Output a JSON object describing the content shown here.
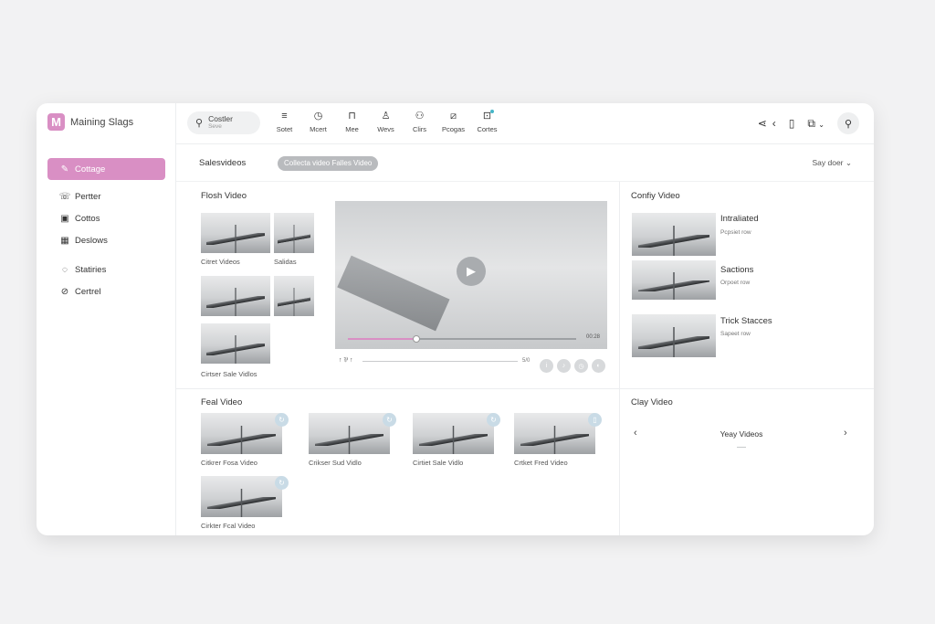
{
  "brand": {
    "logo": "M",
    "name": "Maining Slags"
  },
  "sidebar": {
    "items": [
      {
        "label": "Cottage",
        "icon": "pen-icon",
        "glyph": "✎",
        "active": true
      },
      {
        "label": "Pertter",
        "icon": "phone-icon",
        "glyph": "☏",
        "active": false
      },
      {
        "label": "Cottos",
        "icon": "camera-icon",
        "glyph": "▣",
        "active": false
      },
      {
        "label": "Deslows",
        "icon": "grid-icon",
        "glyph": "▦",
        "active": false
      },
      {
        "label": "Statiries",
        "icon": "chat-icon",
        "glyph": "◌",
        "active": false
      },
      {
        "label": "Certrel",
        "icon": "link-icon",
        "glyph": "⊘",
        "active": false
      }
    ]
  },
  "search": {
    "title": "Costler",
    "subtitle": "Seve"
  },
  "toolbar": {
    "tools": [
      {
        "label": "Sotet",
        "icon": "menu-icon",
        "glyph": "≡"
      },
      {
        "label": "Mcert",
        "icon": "clock-icon",
        "glyph": "◷"
      },
      {
        "label": "Mee",
        "icon": "bag-icon",
        "glyph": "⊓"
      },
      {
        "label": "Wevs",
        "icon": "user-icon",
        "glyph": "♙"
      },
      {
        "label": "Clirs",
        "icon": "users-icon",
        "glyph": "⚇"
      },
      {
        "label": "Pcogas",
        "icon": "image-icon",
        "glyph": "⧄"
      },
      {
        "label": "Cortes",
        "icon": "edit-icon",
        "glyph": "⊡"
      }
    ]
  },
  "subbar": {
    "title": "Salesvideos",
    "pill": "Collecta video Falles Video",
    "sort": "Say doer ⌄"
  },
  "sections": {
    "flash": "Flosh Video",
    "feal": "Feal Video",
    "comfy": "Confiy Video",
    "clay": "Clay Video"
  },
  "flash_captions": [
    "Citret Videos",
    "Salidas",
    "Cirtser Sale Vidlos"
  ],
  "player": {
    "time": "00:28",
    "progress": 0.3,
    "ctrl": "↑  ⅌  ↑",
    "mini_time": "5/0"
  },
  "comfy_list": [
    {
      "title": "Intraliated",
      "subtitle": "Pcpsiet row"
    },
    {
      "title": "Sactions",
      "subtitle": "Orpoet row"
    },
    {
      "title": "Trick Stacces",
      "subtitle": "Sapeet row"
    }
  ],
  "feal_captions": [
    "Citkrer Fosa Video",
    "Crikser Sud Vidlo",
    "Cirtiet Sale Vidlo",
    "Crtket Fred Video",
    "Cirkter Fcal Video"
  ],
  "clay": {
    "label": "Yeay Videos"
  }
}
